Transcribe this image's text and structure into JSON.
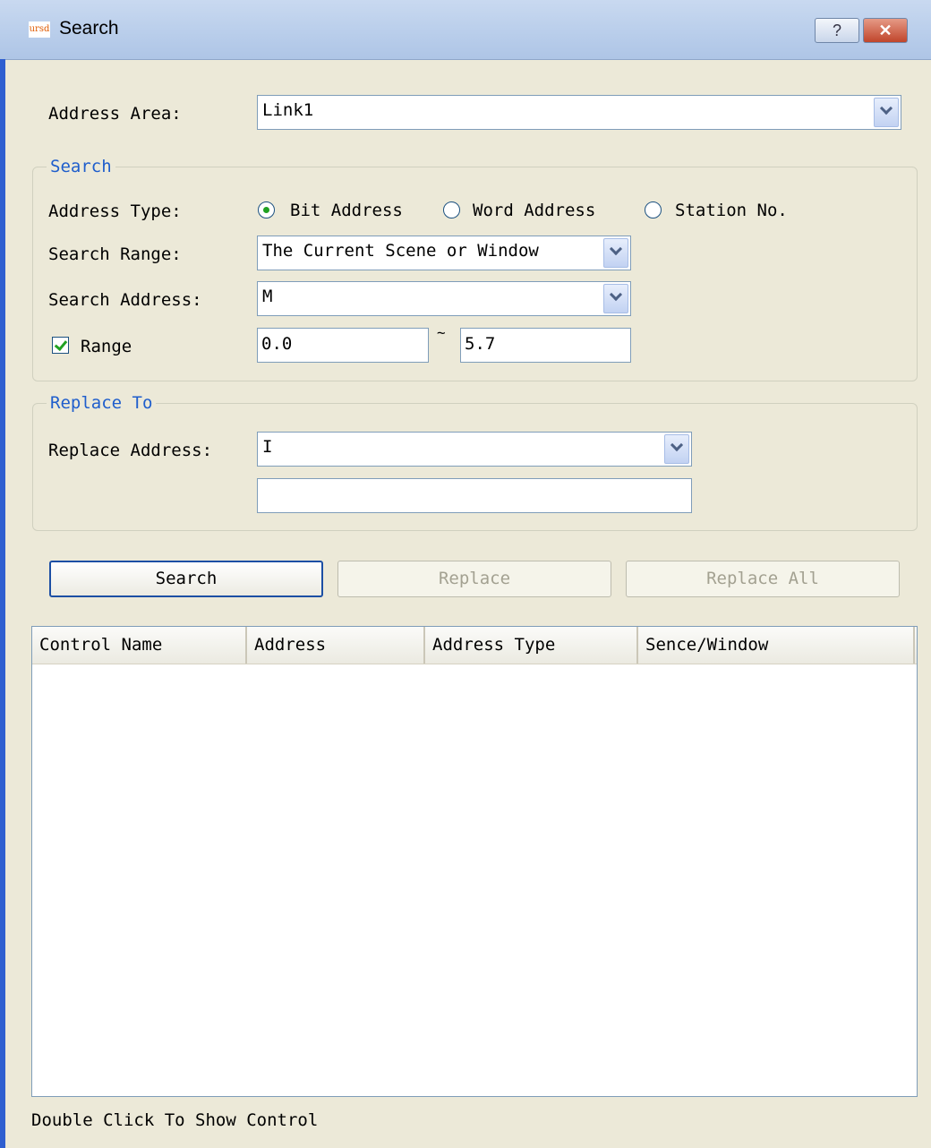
{
  "window": {
    "title": "Search",
    "app_icon_text": "ursd",
    "help_label": "?",
    "close_label": "✕",
    "icons": {
      "help": "help-icon",
      "close": "close-icon",
      "app": "app-icon"
    }
  },
  "address_area": {
    "label": "Address Area:",
    "value": "Link1"
  },
  "search_group": {
    "title": "Search",
    "address_type": {
      "label": "Address Type:",
      "options": [
        "Bit Address",
        "Word Address",
        "Station No."
      ],
      "selected": "Bit Address"
    },
    "search_range": {
      "label": "Search Range:",
      "value": "The Current Scene or Window"
    },
    "search_address": {
      "label": "Search Address:",
      "value": "M"
    },
    "range": {
      "label": "Range",
      "checked": true,
      "from": "0.0",
      "separator": "~",
      "to": "5.7"
    }
  },
  "replace_group": {
    "title": "Replace To",
    "replace_address": {
      "label": "Replace Address:",
      "value": "I"
    },
    "replace_value": ""
  },
  "buttons": {
    "search": "Search",
    "replace": "Replace",
    "replace_all": "Replace All"
  },
  "results": {
    "columns": [
      "Control Name",
      "Address",
      "Address Type",
      "Sence/Window"
    ],
    "rows": []
  },
  "status": {
    "hint": "Double Click To Show Control"
  },
  "colors": {
    "group_title": "#1f5ecc",
    "accent_check": "#21a121",
    "titlebar": "#bcd0ec",
    "window_bg": "#ece9d8"
  }
}
